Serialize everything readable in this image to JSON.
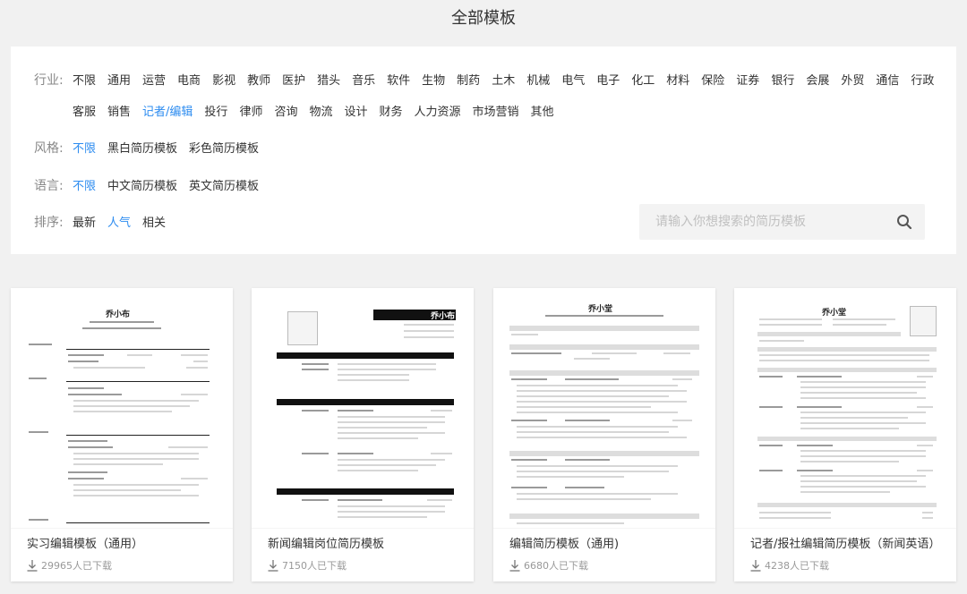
{
  "page_title": "全部模板",
  "filters": {
    "industry": {
      "label": "行业:",
      "options": [
        "不限",
        "通用",
        "运营",
        "电商",
        "影视",
        "教师",
        "医护",
        "猎头",
        "音乐",
        "软件",
        "生物",
        "制药",
        "土木",
        "机械",
        "电气",
        "电子",
        "化工",
        "材料",
        "保险",
        "证券",
        "银行",
        "会展",
        "外贸",
        "通信",
        "行政",
        "客服",
        "销售",
        "记者/编辑",
        "投行",
        "律师",
        "咨询",
        "物流",
        "设计",
        "财务",
        "人力资源",
        "市场营销",
        "其他"
      ],
      "active": "记者/编辑"
    },
    "style": {
      "label": "风格:",
      "options": [
        "不限",
        "黑白简历模板",
        "彩色简历模板"
      ],
      "active": "不限"
    },
    "language": {
      "label": "语言:",
      "options": [
        "不限",
        "中文简历模板",
        "英文简历模板"
      ],
      "active": "不限"
    },
    "sort": {
      "label": "排序:",
      "options": [
        "最新",
        "人气",
        "相关"
      ],
      "active": "人气"
    }
  },
  "search": {
    "placeholder": "请输入你想搜索的简历模板",
    "icon": "search-icon"
  },
  "colors": {
    "accent": "#2d8cf0",
    "background": "#f1f1f1"
  },
  "cards": [
    {
      "title": "实习编辑模板（通用）",
      "downloads": "29965人已下载",
      "resume_name": "乔小布",
      "icon": "download-icon"
    },
    {
      "title": "新闻编辑岗位简历模板",
      "downloads": "7150人已下载",
      "resume_name": "乔小布",
      "icon": "download-icon"
    },
    {
      "title": "编辑简历模板（通用)",
      "downloads": "6680人已下载",
      "resume_name": "乔小堂",
      "icon": "download-icon"
    },
    {
      "title": "记者/报社编辑简历模板（新闻英语）",
      "downloads": "4238人已下载",
      "resume_name": "乔小堂",
      "icon": "download-icon"
    }
  ]
}
